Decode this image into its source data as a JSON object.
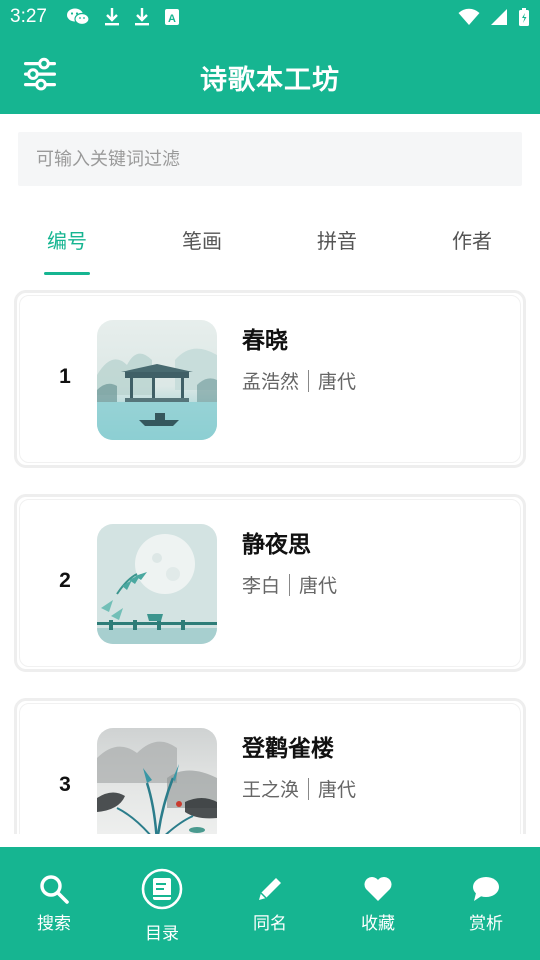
{
  "status_bar": {
    "time": "3:27"
  },
  "app_bar": {
    "title": "诗歌本工坊",
    "filter_icon": "sliders-icon"
  },
  "search": {
    "placeholder": "可输入关键词过滤",
    "value": ""
  },
  "tabs": [
    {
      "label": "编号",
      "active": true
    },
    {
      "label": "笔画",
      "active": false
    },
    {
      "label": "拼音",
      "active": false
    },
    {
      "label": "作者",
      "active": false
    }
  ],
  "poems": [
    {
      "number": "1",
      "title": "春晓",
      "author": "孟浩然",
      "dynasty": "唐代"
    },
    {
      "number": "2",
      "title": "静夜思",
      "author": "李白",
      "dynasty": "唐代"
    },
    {
      "number": "3",
      "title": "登鹳雀楼",
      "author": "王之涣",
      "dynasty": "唐代"
    }
  ],
  "bottom_nav": [
    {
      "label": "搜索",
      "icon": "search-icon",
      "active": false
    },
    {
      "label": "目录",
      "icon": "book-icon",
      "active": true
    },
    {
      "label": "同名",
      "icon": "pencil-icon",
      "active": false
    },
    {
      "label": "收藏",
      "icon": "heart-icon",
      "active": false
    },
    {
      "label": "赏析",
      "icon": "chat-bubble-icon",
      "active": false
    }
  ],
  "colors": {
    "accent": "#16b591",
    "background": "#ffffff",
    "card_border": "#eeeeee"
  }
}
